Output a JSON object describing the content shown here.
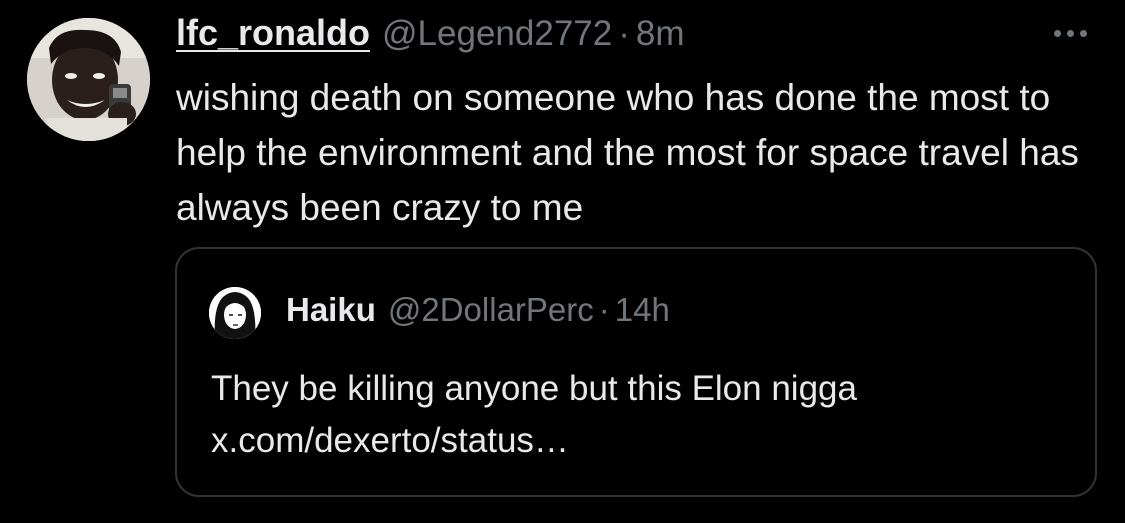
{
  "tweet": {
    "display_name": "lfc_ronaldo",
    "handle": "@Legend2772",
    "separator": "·",
    "time": "8m",
    "more_icon": "ellipsis-icon",
    "text": "wishing death on someone who has done the most to help the environment and the most for space travel has always been crazy to me"
  },
  "quote": {
    "display_name": "Haiku",
    "handle": "@2DollarPerc",
    "separator": "·",
    "time": "14h",
    "text_line1": "They be killing anyone but this Elon nigga",
    "link": "x.com/dexerto/status…"
  },
  "colors": {
    "background": "#000000",
    "primary_text": "#e7e9ea",
    "secondary_text": "#71767b",
    "border": "#2f3336"
  }
}
